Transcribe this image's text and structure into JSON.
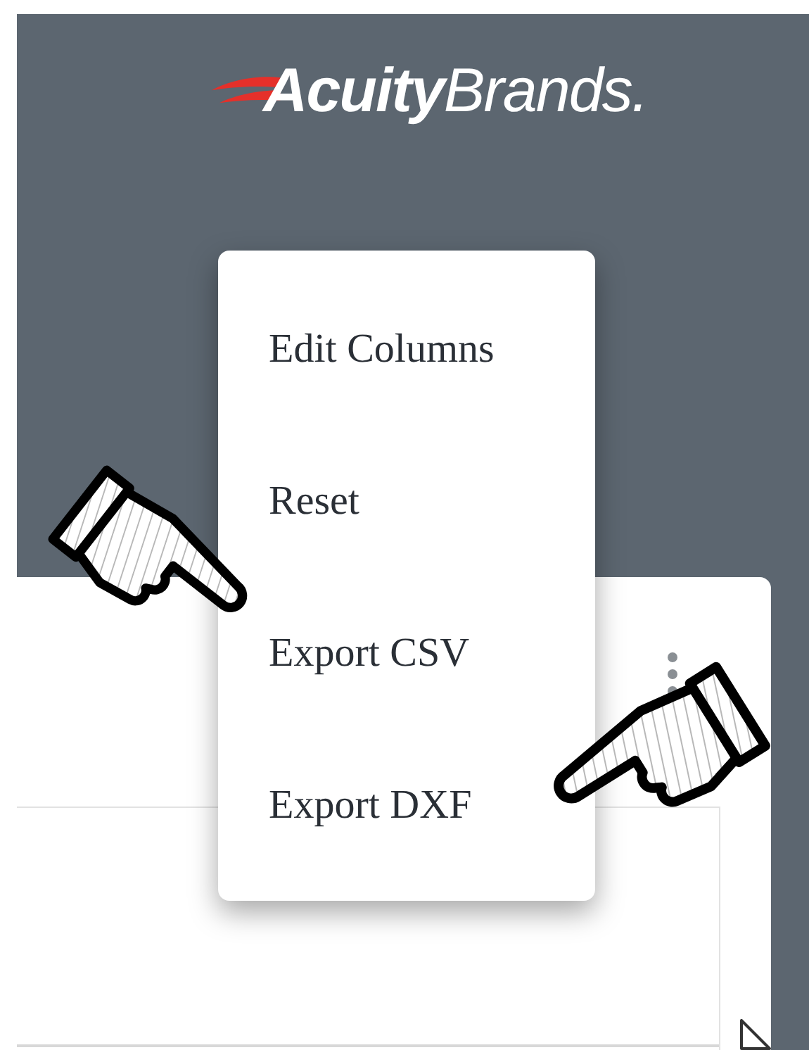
{
  "logo": {
    "text": "**Acuity**Brands."
  },
  "menu": {
    "items": [
      "Edit Columns",
      "Reset",
      "Export CSV",
      "Export DXF"
    ]
  }
}
